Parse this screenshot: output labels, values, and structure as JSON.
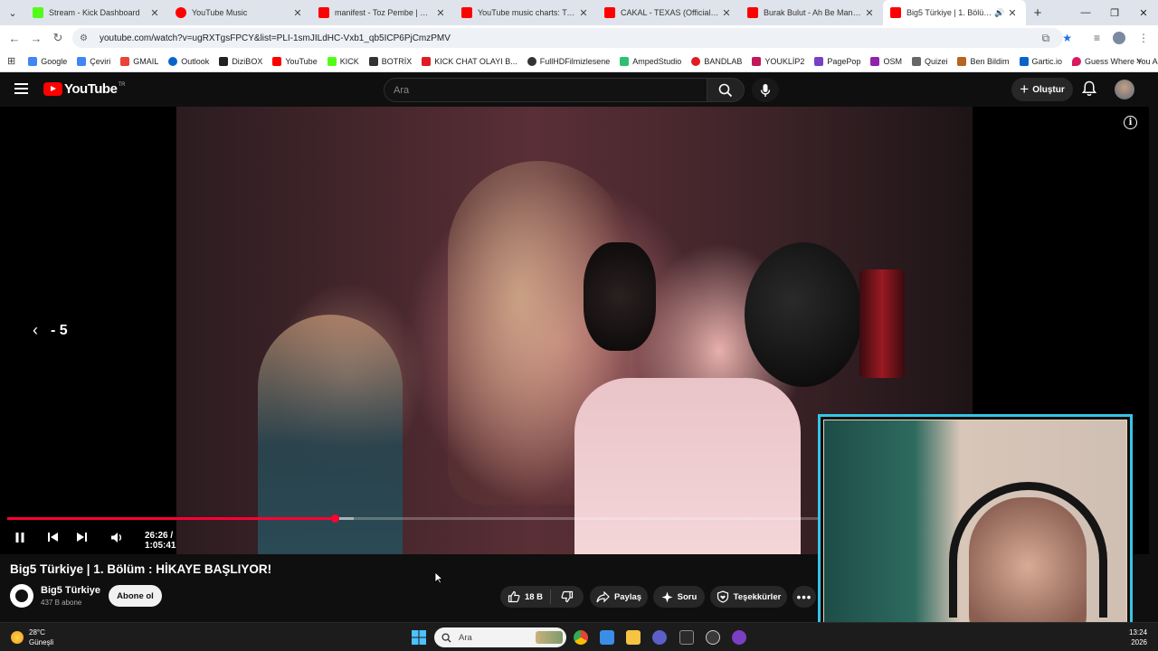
{
  "browser": {
    "tabs": [
      {
        "title": "Stream - Kick Dashboard",
        "favicon_color": "#53fc18"
      },
      {
        "title": "YouTube Music",
        "favicon_color": "#ff0000"
      },
      {
        "title": "manifest - Toz Pembe | Official",
        "favicon_color": "#ff0000"
      },
      {
        "title": "YouTube music charts: Turkey",
        "favicon_color": "#ff0000"
      },
      {
        "title": "CAKAL - TEXAS (Official Music",
        "favicon_color": "#ff0000"
      },
      {
        "title": "Burak Bulut - Ah Be Manolya |(",
        "favicon_color": "#ff0000"
      },
      {
        "title": "Big5 Türkiye | 1. Bölüm : Hİ",
        "favicon_color": "#ff0000"
      }
    ],
    "url": "youtube.com/watch?v=ugRXTgsFPCY&list=PLI-1smJILdHC-Vxb1_qb5ICP6PjCmzPMV",
    "bookmarks": [
      {
        "label": "Google",
        "color": "#4285f4"
      },
      {
        "label": "Çeviri",
        "color": "#4285f4"
      },
      {
        "label": "GMAIL",
        "color": "#ea4335"
      },
      {
        "label": "Outlook",
        "color": "#0a64c8"
      },
      {
        "label": "DiziBOX",
        "color": "#222222"
      },
      {
        "label": "YouTube",
        "color": "#ff0000"
      },
      {
        "label": "KICK",
        "color": "#53fc18"
      },
      {
        "label": "BOTRİX",
        "color": "#333333"
      },
      {
        "label": "KICK CHAT OLAYI B...",
        "color": "#e01b22"
      },
      {
        "label": "FullHDFilmizlesene",
        "color": "#333333"
      },
      {
        "label": "AmpedStudio",
        "color": "#2fbf71"
      },
      {
        "label": "BANDLAB",
        "color": "#e01b22"
      },
      {
        "label": "YOUKLİP2",
        "color": "#c2185b"
      },
      {
        "label": "PagePop",
        "color": "#7b3fc4"
      },
      {
        "label": "OSM",
        "color": "#8e24aa"
      },
      {
        "label": "Quizei",
        "color": "#666666"
      },
      {
        "label": "Ben Bildim",
        "color": "#b5651d"
      },
      {
        "label": "Gartic.io",
        "color": "#0a64c8"
      },
      {
        "label": "Guess Where You Are",
        "color": "#d81b60"
      }
    ]
  },
  "youtube": {
    "region_code": "TR",
    "search_placeholder": "Ara",
    "create_label": "Oluştur"
  },
  "player": {
    "seek_indicator": "- 5",
    "current_time": "26:26",
    "duration": "1:05:41",
    "played_fraction": 0.402,
    "buffered_fraction": 0.425
  },
  "video": {
    "title": "Big5 Türkiye | 1. Bölüm : HİKAYE BAŞLIYOR!",
    "channel": "Big5 Türkiye",
    "subscribers": "437 B abone",
    "subscribe_label": "Abone ol",
    "likes": "18 B",
    "share_label": "Paylaş",
    "ask_label": "Soru",
    "thanks_label": "Teşekkürler"
  },
  "taskbar": {
    "temperature": "28°C",
    "weather_text": "Güneşli",
    "search_placeholder": "Ara",
    "time": "13:24",
    "date": "2026"
  },
  "colors": {
    "accent_red": "#ff0033",
    "webcam_border": "#35c6e8"
  }
}
